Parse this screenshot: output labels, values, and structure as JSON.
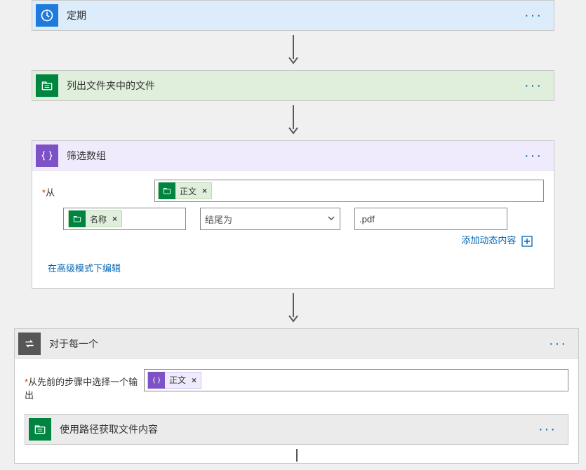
{
  "steps": {
    "recurrence": {
      "title": "定期"
    },
    "listFiles": {
      "title": "列出文件夹中的文件"
    },
    "filter": {
      "title": "筛选数组",
      "fromLabel": "从",
      "tokenBody": "正文",
      "condLeftToken": "名称",
      "condOperator": "结尾为",
      "condValue": ".pdf",
      "addDynamic": "添加动态内容",
      "advancedEdit": "在高级模式下编辑"
    },
    "forEach": {
      "title": "对于每一个",
      "selectLabel": "从先前的步骤中选择一个输出",
      "tokenBody": "正文"
    },
    "getFileContent": {
      "title": "使用路径获取文件内容"
    }
  }
}
